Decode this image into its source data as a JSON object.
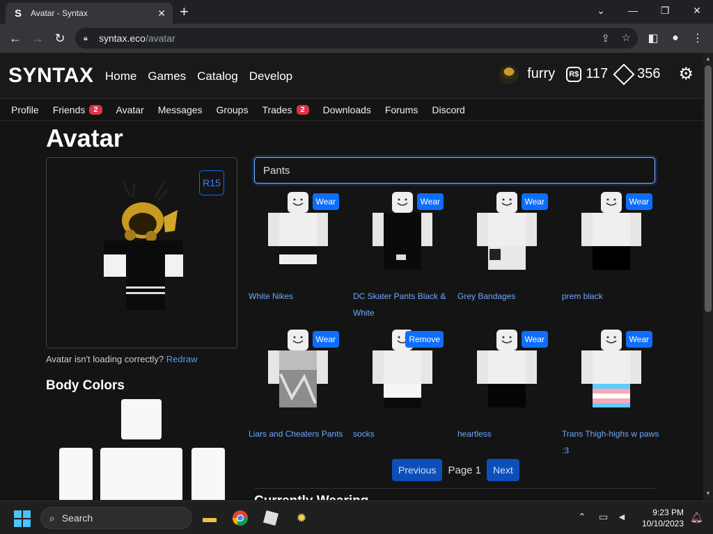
{
  "browser": {
    "tab_title": "Avatar - Syntax",
    "tab_favicon": "S",
    "url_host": "syntax.eco",
    "url_path": "/avatar"
  },
  "site": {
    "logo": "SYNTAX",
    "nav": [
      "Home",
      "Games",
      "Catalog",
      "Develop"
    ],
    "username": "furry",
    "robux_icon": "R$",
    "robux": "117",
    "tix": "356",
    "subnav": [
      {
        "label": "Profile"
      },
      {
        "label": "Friends",
        "badge": "2"
      },
      {
        "label": "Avatar"
      },
      {
        "label": "Messages"
      },
      {
        "label": "Groups"
      },
      {
        "label": "Trades",
        "badge": "2"
      },
      {
        "label": "Downloads"
      },
      {
        "label": "Forums"
      },
      {
        "label": "Discord"
      }
    ]
  },
  "page": {
    "title": "Avatar",
    "r15_label": "R15",
    "loading_note": "Avatar isn't loading correctly?",
    "redraw": "Redraw",
    "body_colors_title": "Body Colors",
    "search_value": "Pants",
    "currently_wearing": "Currently Wearing"
  },
  "items": [
    {
      "name": "White Nikes",
      "action": "Wear",
      "pants": "#111111"
    },
    {
      "name": "DC Skater Pants Black & White",
      "action": "Wear",
      "pants": "#0a0a0a"
    },
    {
      "name": "Grey Bandages",
      "action": "Wear",
      "pants": "#e8e8e8"
    },
    {
      "name": "prem black",
      "action": "Wear",
      "pants": "#000000"
    },
    {
      "name": "Liars and Cheaters Pants",
      "action": "Wear",
      "pants": "#9a9a9a"
    },
    {
      "name": "socks",
      "action": "Remove",
      "pants": "#ffffff"
    },
    {
      "name": "heartless",
      "action": "Wear",
      "pants": "#050505"
    },
    {
      "name": "Trans Thigh-highs w paws :3",
      "action": "Wear",
      "pants": "#f3f3f3"
    }
  ],
  "pager": {
    "previous": "Previous",
    "page": "Page 1",
    "next": "Next"
  },
  "taskbar": {
    "search": "Search",
    "time": "9:23 PM",
    "date": "10/10/2023"
  },
  "colors": {
    "accent": "#0d6efd",
    "link": "#6ea8fe",
    "badge": "#dc3545",
    "page_bg": "#141414"
  }
}
